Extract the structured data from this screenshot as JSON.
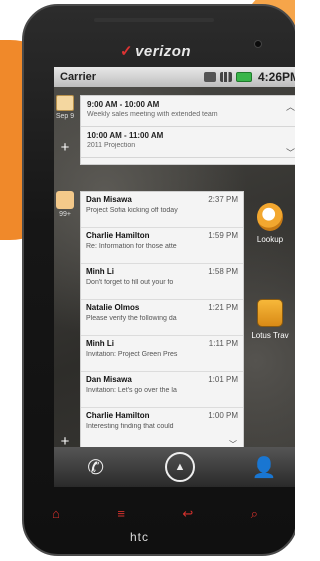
{
  "brand": "verizon",
  "device_logo": "htc",
  "status_bar": {
    "carrier": "Carrier",
    "time": "4:26PM",
    "icons": [
      "sync-icon",
      "signal-icon",
      "battery-icon"
    ]
  },
  "calendar_widget": {
    "date": "Sep 9",
    "events": [
      {
        "time": "9:00 AM - 10:00 AM",
        "title": "Weekly sales meeting with extended team"
      },
      {
        "time": "10:00 AM - 11:00 AM",
        "title": "2011 Projection"
      }
    ]
  },
  "mail_widget": {
    "count": "99+",
    "messages": [
      {
        "from": "Dan Misawa",
        "time": "2:37 PM",
        "subject": "Project Sofia kicking off today"
      },
      {
        "from": "Charlie Hamilton",
        "time": "1:59 PM",
        "subject": "Re: Information for those atte"
      },
      {
        "from": "Minh Li",
        "time": "1:58 PM",
        "subject": "Don't forget to fill out your fo"
      },
      {
        "from": "Natalie Olmos",
        "time": "1:21 PM",
        "subject": "Please verify the following da"
      },
      {
        "from": "Minh Li",
        "time": "1:11 PM",
        "subject": "Invitation: Project Green Pres"
      },
      {
        "from": "Dan Misawa",
        "time": "1:01 PM",
        "subject": "Invitation: Let's go over the la"
      },
      {
        "from": "Charlie Hamilton",
        "time": "1:00 PM",
        "subject": "Interesting finding that could"
      }
    ]
  },
  "apps": [
    {
      "label": "Lookup",
      "icon": "magnifier-icon"
    },
    {
      "label": "Lotus Trav",
      "icon": "travel-icon"
    }
  ],
  "dock": [
    "phone-icon",
    "launcher-icon",
    "contacts-icon"
  ],
  "softkeys": [
    "home-icon",
    "menu-icon",
    "back-icon",
    "search-icon"
  ]
}
